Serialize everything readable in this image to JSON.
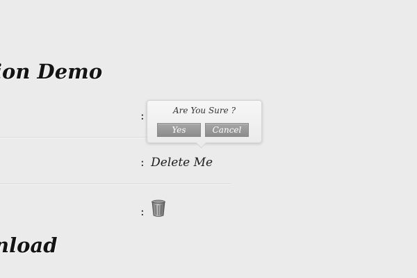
{
  "headings": {
    "demo": "ion Demo",
    "download": "nload"
  },
  "rows": [
    {
      "separator": ":"
    },
    {
      "separator": ":",
      "link_text": "Delete Me"
    },
    {
      "separator": ":",
      "icon": "trash-can-icon"
    }
  ],
  "confirm": {
    "question": "Are You Sure ?",
    "yes_label": "Yes",
    "cancel_label": "Cancel"
  }
}
